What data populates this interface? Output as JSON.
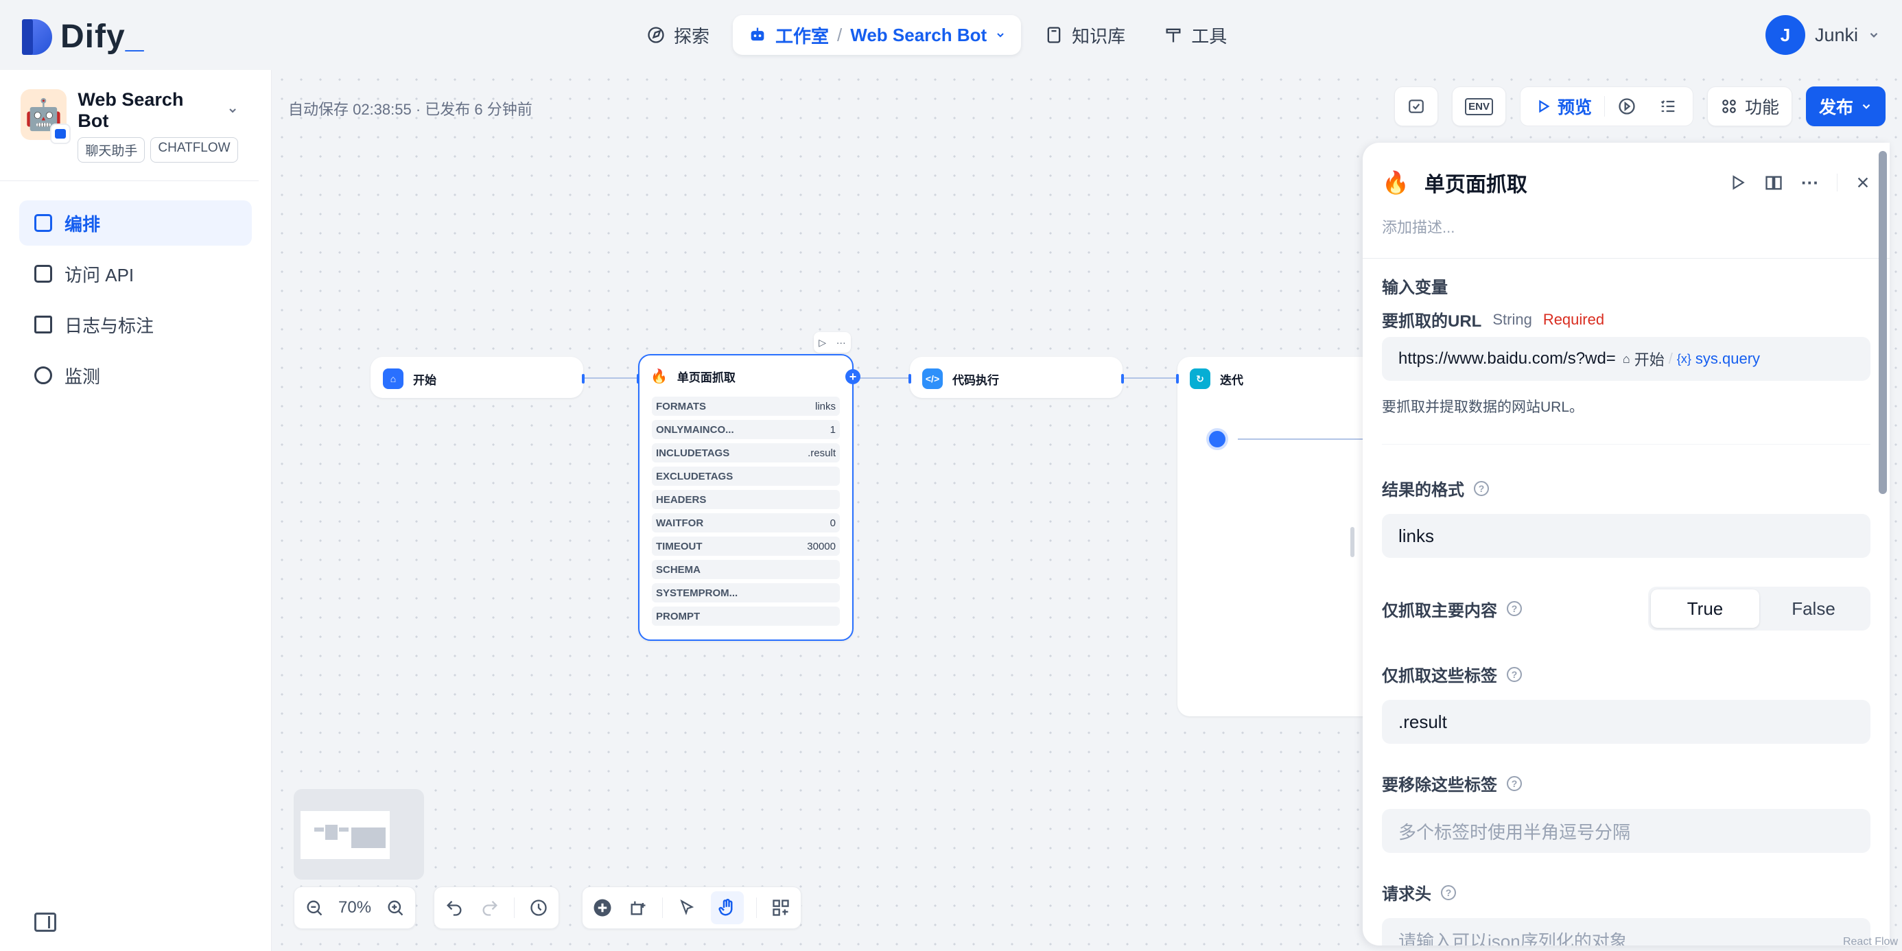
{
  "brand": {
    "name": "Dify",
    "suffix": "_"
  },
  "topnav": {
    "explore": "探索",
    "studio": "工作室",
    "separator": "/",
    "current_app": "Web Search Bot",
    "knowledge": "知识库",
    "tools": "工具"
  },
  "user": {
    "initial": "J",
    "name": "Junki"
  },
  "app": {
    "name": "Web Search Bot",
    "badge_mode": "聊天助手",
    "badge_type": "CHATFLOW",
    "emoji": "🤖"
  },
  "sidebar": {
    "items": [
      {
        "label": "编排",
        "active": true
      },
      {
        "label": "访问 API",
        "active": false
      },
      {
        "label": "日志与标注",
        "active": false
      },
      {
        "label": "监测",
        "active": false
      }
    ]
  },
  "autosave": "自动保存 02:38:55 · 已发布 6 分钟前",
  "toolbar": {
    "env": "ENV",
    "preview": "预览",
    "features": "功能",
    "publish": "发布"
  },
  "nodes": {
    "start": {
      "title": "开始"
    },
    "scrape": {
      "title": "单页面抓取",
      "rows": [
        {
          "key": "FORMATS",
          "value": "links"
        },
        {
          "key": "ONLYMAINCO...",
          "value": "1"
        },
        {
          "key": "INCLUDETAGS",
          "value": ".result"
        },
        {
          "key": "EXCLUDETAGS",
          "value": ""
        },
        {
          "key": "HEADERS",
          "value": ""
        },
        {
          "key": "WAITFOR",
          "value": "0"
        },
        {
          "key": "TIMEOUT",
          "value": "30000"
        },
        {
          "key": "SCHEMA",
          "value": ""
        },
        {
          "key": "SYSTEMPROM...",
          "value": ""
        },
        {
          "key": "PROMPT",
          "value": ""
        }
      ]
    },
    "code": {
      "title": "代码执行"
    },
    "iteration": {
      "title": "迭代"
    }
  },
  "panel": {
    "title": "单页面抓取",
    "description_placeholder": "添加描述...",
    "inputs_heading": "输入变量",
    "url": {
      "label": "要抓取的URL",
      "type": "String",
      "required": "Required",
      "value": "https://www.baidu.com/s?wd=",
      "var_node": "开始",
      "var_sep": "/",
      "var_name": "sys.query",
      "hint": "要抓取并提取数据的网站URL。"
    },
    "format": {
      "label": "结果的格式",
      "value": "links"
    },
    "only_main": {
      "label": "仅抓取主要内容",
      "true_label": "True",
      "false_label": "False",
      "selected": "True"
    },
    "include_tags": {
      "label": "仅抓取这些标签",
      "value": ".result"
    },
    "exclude_tags": {
      "label": "要移除这些标签",
      "placeholder": "多个标签时使用半角逗号分隔"
    },
    "headers": {
      "label": "请求头",
      "placeholder": "请输入可以json序列化的对象"
    }
  },
  "zoom": "70%",
  "attribution": "React Flow",
  "colors": {
    "accent": "#155eef",
    "required": "#d92d20",
    "scrape_emoji": "🔥"
  }
}
